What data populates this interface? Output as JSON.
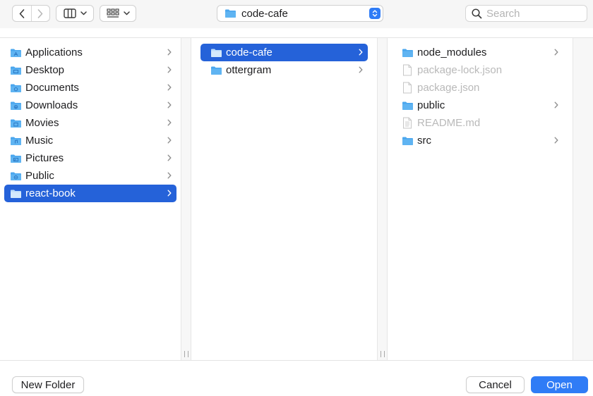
{
  "toolbar": {
    "back_icon": "chevron-left-icon",
    "forward_icon": "chevron-right-icon",
    "column_view_icon": "column-view-icon",
    "group_view_icon": "grid-view-icon",
    "path": {
      "label": "code-cafe",
      "icon": "folder-icon"
    },
    "search": {
      "placeholder": "Search",
      "value": ""
    }
  },
  "columns": [
    {
      "items": [
        {
          "label": "Applications",
          "icon": "applications-folder-icon",
          "has_children": true,
          "selected": false,
          "enabled": true
        },
        {
          "label": "Desktop",
          "icon": "desktop-folder-icon",
          "has_children": true,
          "selected": false,
          "enabled": true
        },
        {
          "label": "Documents",
          "icon": "documents-folder-icon",
          "has_children": true,
          "selected": false,
          "enabled": true
        },
        {
          "label": "Downloads",
          "icon": "downloads-folder-icon",
          "has_children": true,
          "selected": false,
          "enabled": true
        },
        {
          "label": "Movies",
          "icon": "movies-folder-icon",
          "has_children": true,
          "selected": false,
          "enabled": true
        },
        {
          "label": "Music",
          "icon": "music-folder-icon",
          "has_children": true,
          "selected": false,
          "enabled": true
        },
        {
          "label": "Pictures",
          "icon": "pictures-folder-icon",
          "has_children": true,
          "selected": false,
          "enabled": true
        },
        {
          "label": "Public",
          "icon": "public-folder-icon",
          "has_children": true,
          "selected": false,
          "enabled": true
        },
        {
          "label": "react-book",
          "icon": "folder-icon",
          "has_children": true,
          "selected": true,
          "enabled": true
        }
      ]
    },
    {
      "items": [
        {
          "label": "code-cafe",
          "icon": "folder-icon",
          "has_children": true,
          "selected": true,
          "enabled": true
        },
        {
          "label": "ottergram",
          "icon": "folder-icon",
          "has_children": true,
          "selected": false,
          "enabled": true
        }
      ]
    },
    {
      "items": [
        {
          "label": "node_modules",
          "icon": "folder-icon",
          "has_children": true,
          "selected": false,
          "enabled": true
        },
        {
          "label": "package-lock.json",
          "icon": "file-icon",
          "has_children": false,
          "selected": false,
          "enabled": false
        },
        {
          "label": "package.json",
          "icon": "file-icon",
          "has_children": false,
          "selected": false,
          "enabled": false
        },
        {
          "label": "public",
          "icon": "folder-icon",
          "has_children": true,
          "selected": false,
          "enabled": true
        },
        {
          "label": "README.md",
          "icon": "text-file-icon",
          "has_children": false,
          "selected": false,
          "enabled": false
        },
        {
          "label": "src",
          "icon": "folder-icon",
          "has_children": true,
          "selected": false,
          "enabled": true
        }
      ]
    }
  ],
  "buttons": {
    "new_folder": "New Folder",
    "cancel": "Cancel",
    "open": "Open"
  },
  "colors": {
    "accent": "#2f7cf6",
    "selection": "#2562d9",
    "folder": "#4aa6ee",
    "disabled_text": "#b9b9b9"
  }
}
